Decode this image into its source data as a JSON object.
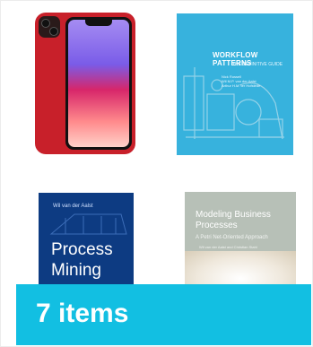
{
  "products": [
    {
      "name": "iphone-product",
      "kind": "phone"
    },
    {
      "name": "workflow-patterns-book",
      "title": "WORKFLOW PATTERNS",
      "subtitle": "THE DEFINITIVE GUIDE",
      "authors": "Nick Russell\nWil M.P. van der Aalst\nArthur H.M. ter Hofstede"
    },
    {
      "name": "process-mining-book",
      "author": "Wil van der Aalst",
      "title": "Process Mining"
    },
    {
      "name": "modeling-business-processes-book",
      "title": "Modeling Business Processes",
      "subtitle": "A Petri Net-Oriented Approach",
      "authors": "Wil van der Aalst and Christian Stahl"
    }
  ],
  "banner": {
    "count_label": "7 items"
  },
  "colors": {
    "banner_bg": "#12bfe2",
    "phone_red": "#c8202a",
    "book1_bg": "#37b2dd",
    "book2_bg": "#0d3b82"
  }
}
